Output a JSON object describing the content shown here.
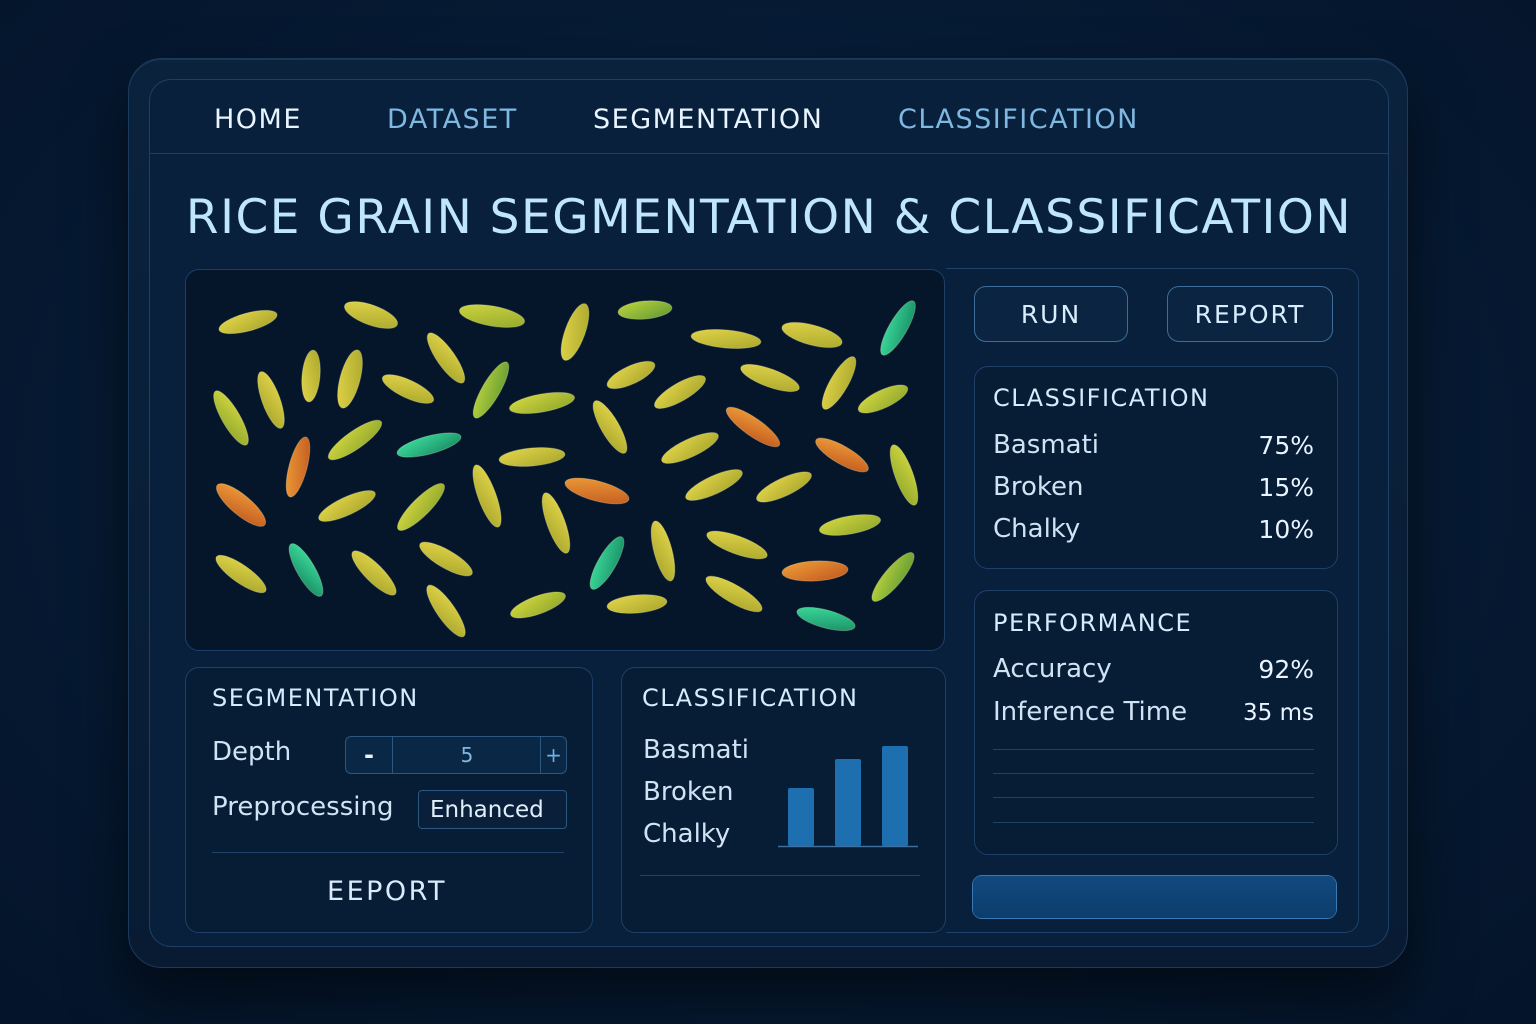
{
  "nav": {
    "items": [
      "HOME",
      "DATASET",
      "SEGMENTATION",
      "CLASSIFICATION"
    ]
  },
  "page_title": "RICE GRAIN SEGMENTATION & CLASSIFICATION",
  "actions": {
    "run_label": "RUN",
    "report_label": "REPORT"
  },
  "classification_card": {
    "title": "CLASSIFICATION",
    "rows": [
      {
        "label": "Basmati",
        "value": "75%"
      },
      {
        "label": "Broken",
        "value": "15%"
      },
      {
        "label": "Chalky",
        "value": "10%"
      }
    ]
  },
  "performance_card": {
    "title": "PERFORMANCE",
    "rows": [
      {
        "label": "Accuracy",
        "value": "92%"
      },
      {
        "label": "Inference Time",
        "value": "35 ms"
      }
    ]
  },
  "progress": {
    "fraction": 1.0
  },
  "segmentation_card": {
    "title": "SEGMENTATION",
    "depth_label": "Depth",
    "depth_minus": "-",
    "depth_value": "5",
    "depth_plus": "+",
    "preprocessing_label": "Preprocessing",
    "preprocessing_value": "Enhanced",
    "export_label": "EEPORT"
  },
  "classification_chart_card": {
    "title": "CLASSIFICATION",
    "labels": [
      "Basmati",
      "Broken",
      "Chalky"
    ]
  },
  "chart_data": {
    "type": "bar",
    "categories": [
      "Basmati",
      "Broken",
      "Chalky"
    ],
    "values": [
      58,
      87,
      100
    ],
    "ylim": [
      0,
      100
    ]
  },
  "colors": {
    "accent": "#1f6fb5",
    "bar": "#1e6fb0",
    "grain_yellow": "#c8c23a",
    "grain_green": "#2fc28a",
    "grain_orange": "#e07a2a"
  }
}
